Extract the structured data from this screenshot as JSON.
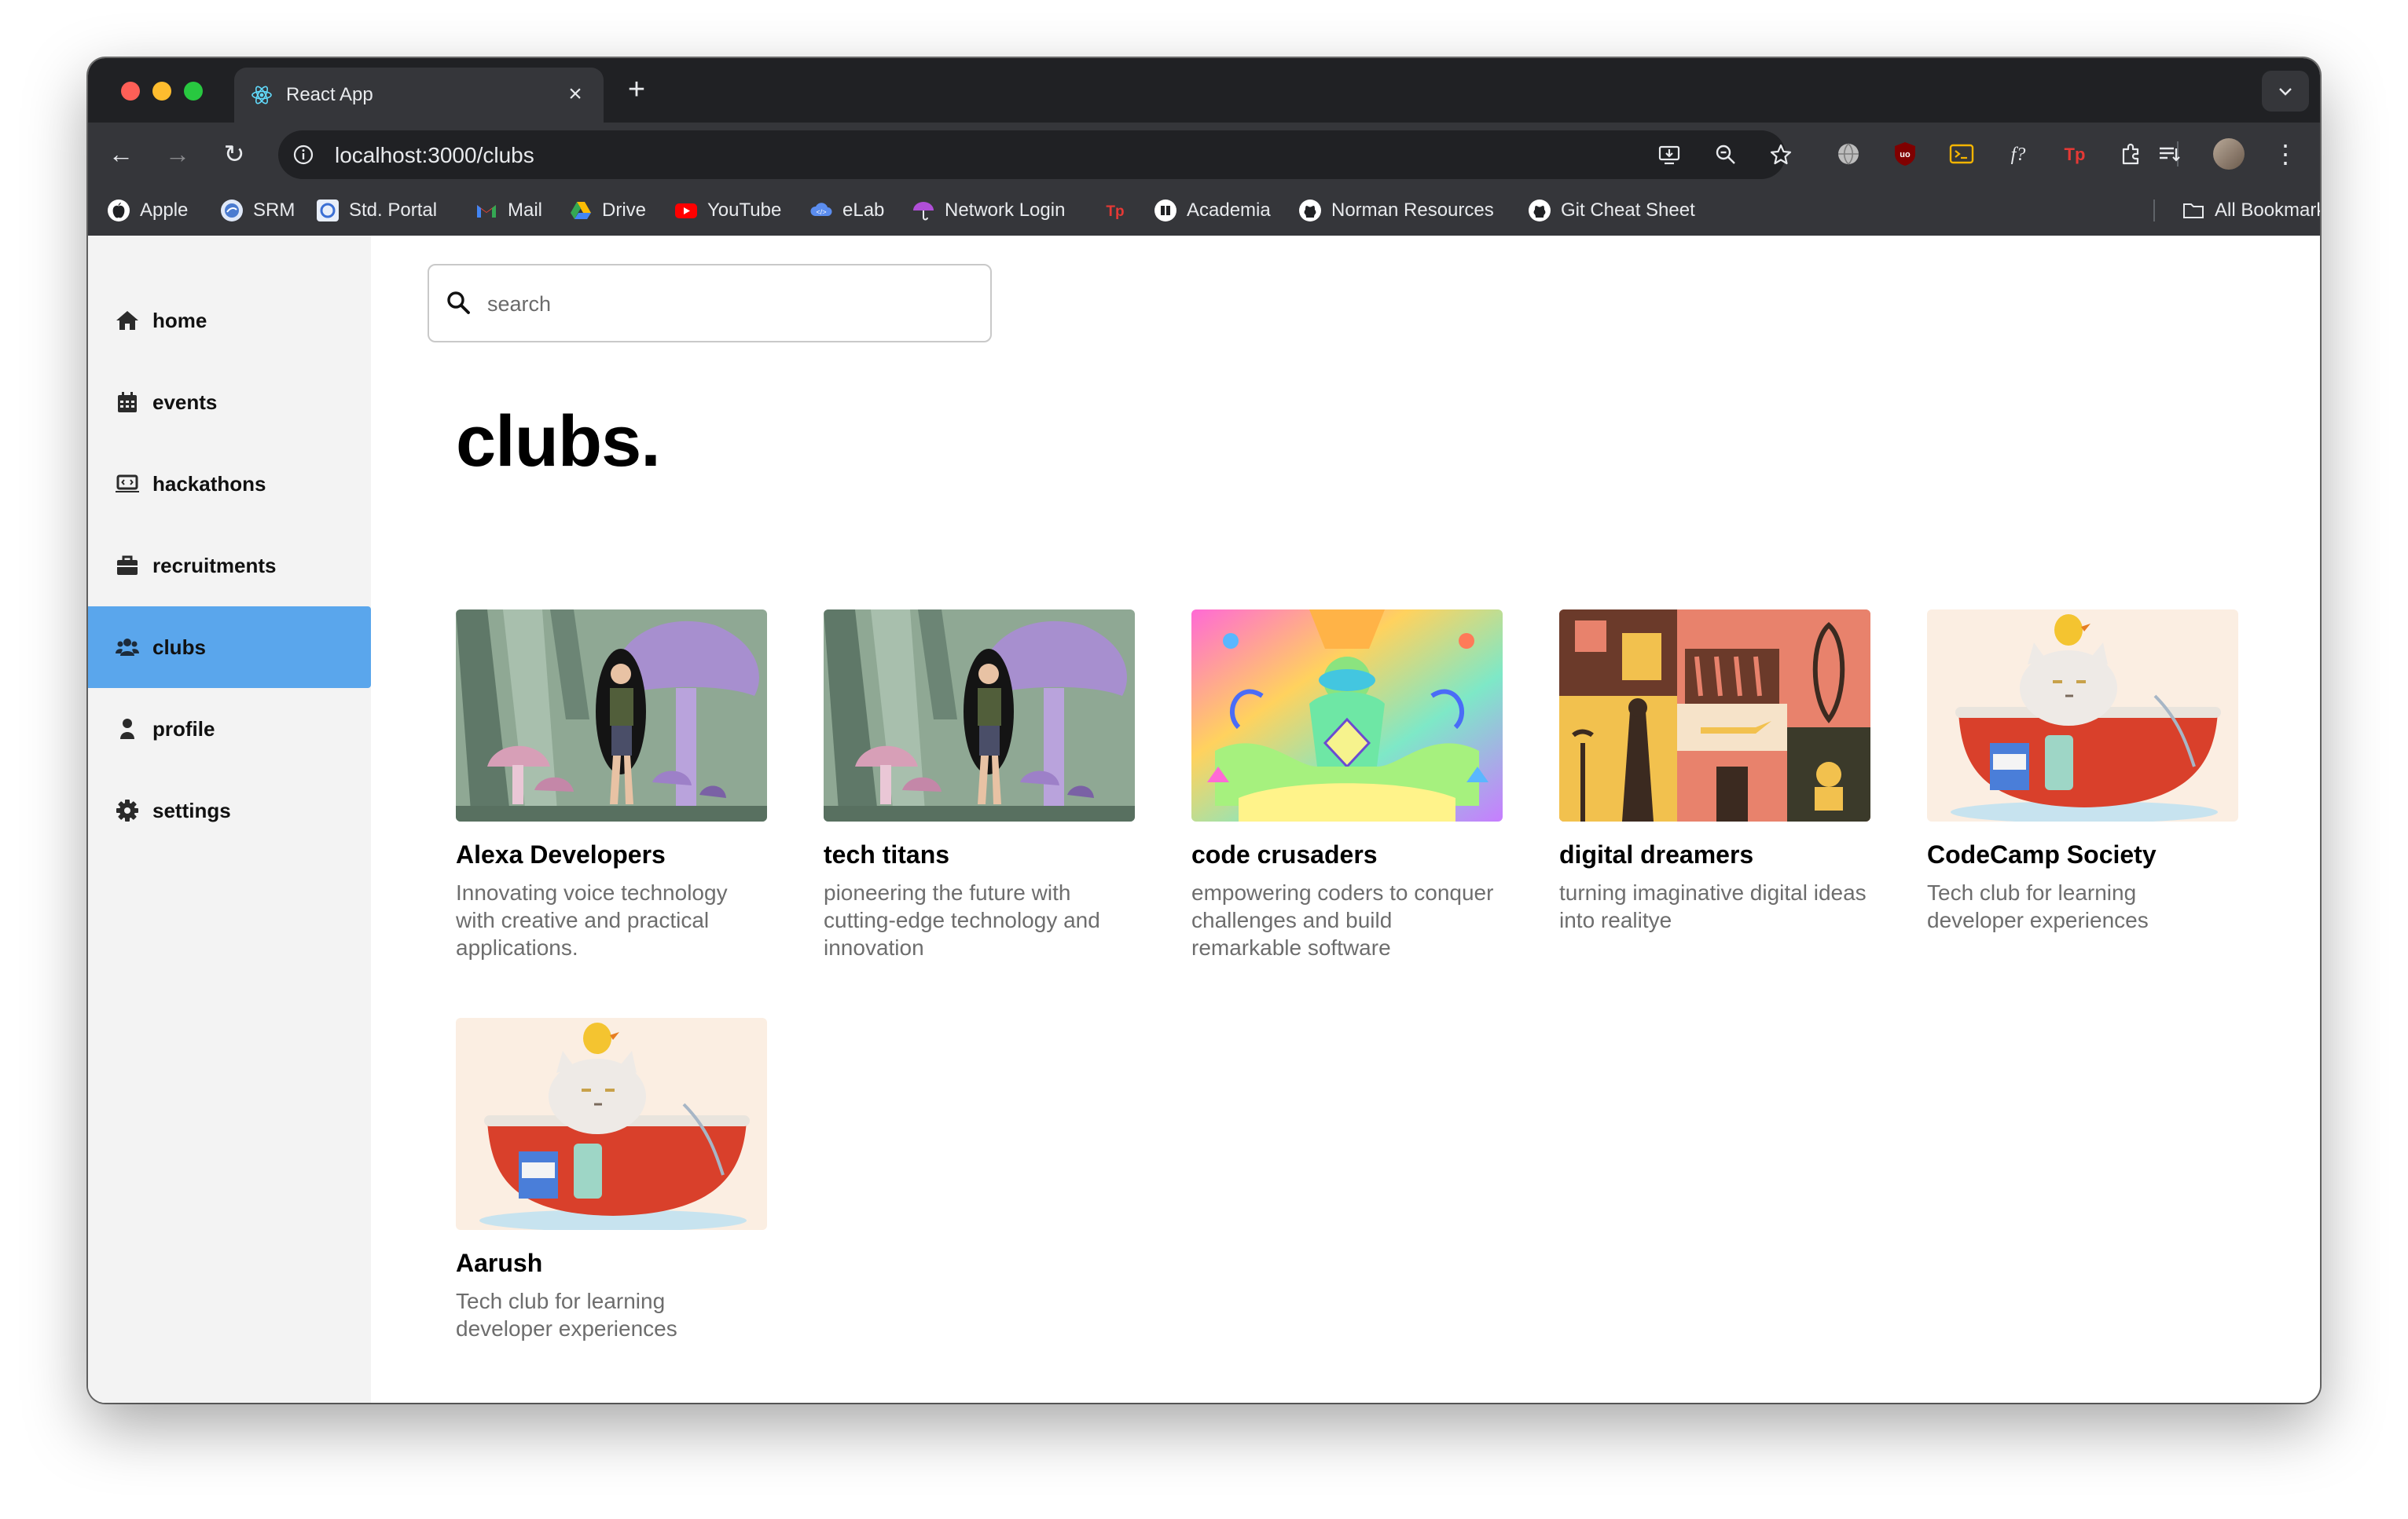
{
  "browser": {
    "tab_title": "React App",
    "tab_close": "×",
    "new_tab": "+",
    "tab_search": "⌄",
    "url": "localhost:3000/clubs",
    "back": "←",
    "forward": "→",
    "reload": "↻",
    "menu": "⋮"
  },
  "bookmarks": [
    {
      "label": "Apple",
      "icon": "apple-icon",
      "color": "#ffffff"
    },
    {
      "label": "SRM",
      "icon": "srm-icon",
      "color": "#4a7bd0"
    },
    {
      "label": "Std. Portal",
      "icon": "portal-icon",
      "color": "#3b6fd4"
    },
    {
      "label": "Mail",
      "icon": "gmail-icon",
      "color": "#ea4335"
    },
    {
      "label": "Drive",
      "icon": "drive-icon",
      "color": "#34a853"
    },
    {
      "label": "YouTube",
      "icon": "youtube-icon",
      "color": "#ff0000"
    },
    {
      "label": "eLab",
      "icon": "elab-icon",
      "color": "#5b8def"
    },
    {
      "label": "Network Login",
      "icon": "umbrella-icon",
      "color": "#b04fd8"
    },
    {
      "label": "",
      "icon": "tp-icon",
      "color": "#e53935"
    },
    {
      "label": "Academia",
      "icon": "academia-icon",
      "color": "#ffffff"
    },
    {
      "label": "Norman Resources",
      "icon": "github-icon",
      "color": "#ffffff"
    },
    {
      "label": "Git Cheat Sheet",
      "icon": "github-icon",
      "color": "#ffffff"
    }
  ],
  "all_bookmarks": "All Bookmarks",
  "sidebar": {
    "items": [
      {
        "label": "home",
        "icon": "home-icon",
        "active": false
      },
      {
        "label": "events",
        "icon": "calendar-icon",
        "active": false
      },
      {
        "label": "hackathons",
        "icon": "laptop-code-icon",
        "active": false
      },
      {
        "label": "recruitments",
        "icon": "briefcase-icon",
        "active": false
      },
      {
        "label": "clubs",
        "icon": "users-icon",
        "active": true
      },
      {
        "label": "profile",
        "icon": "user-icon",
        "active": false
      },
      {
        "label": "settings",
        "icon": "gear-icon",
        "active": false
      }
    ],
    "active_color": "#5aa6ec"
  },
  "search": {
    "placeholder": "search",
    "value": ""
  },
  "main": {
    "title": "clubs.",
    "clubs": [
      {
        "name": "Alexa Developers",
        "description": "Innovating voice technology with creative and practical applications.",
        "image": "mushroom-forest-illustration"
      },
      {
        "name": "tech titans",
        "description": "pioneering the future with cutting-edge technology and innovation",
        "image": "mushroom-forest-illustration"
      },
      {
        "name": "code crusaders",
        "description": "empowering coders to conquer challenges and build remarkable software",
        "image": "psychedelic-meditation-illustration"
      },
      {
        "name": "digital dreamers",
        "description": "turning imaginative digital ideas into realitye",
        "image": "grid-pattern-illustration"
      },
      {
        "name": "CodeCamp Society",
        "description": "Tech club for learning developer experiences",
        "image": "cat-in-bathtub-illustration"
      },
      {
        "name": "Aarush",
        "description": "Tech club for learning developer experiences",
        "image": "cat-in-bathtub-illustration"
      }
    ]
  }
}
